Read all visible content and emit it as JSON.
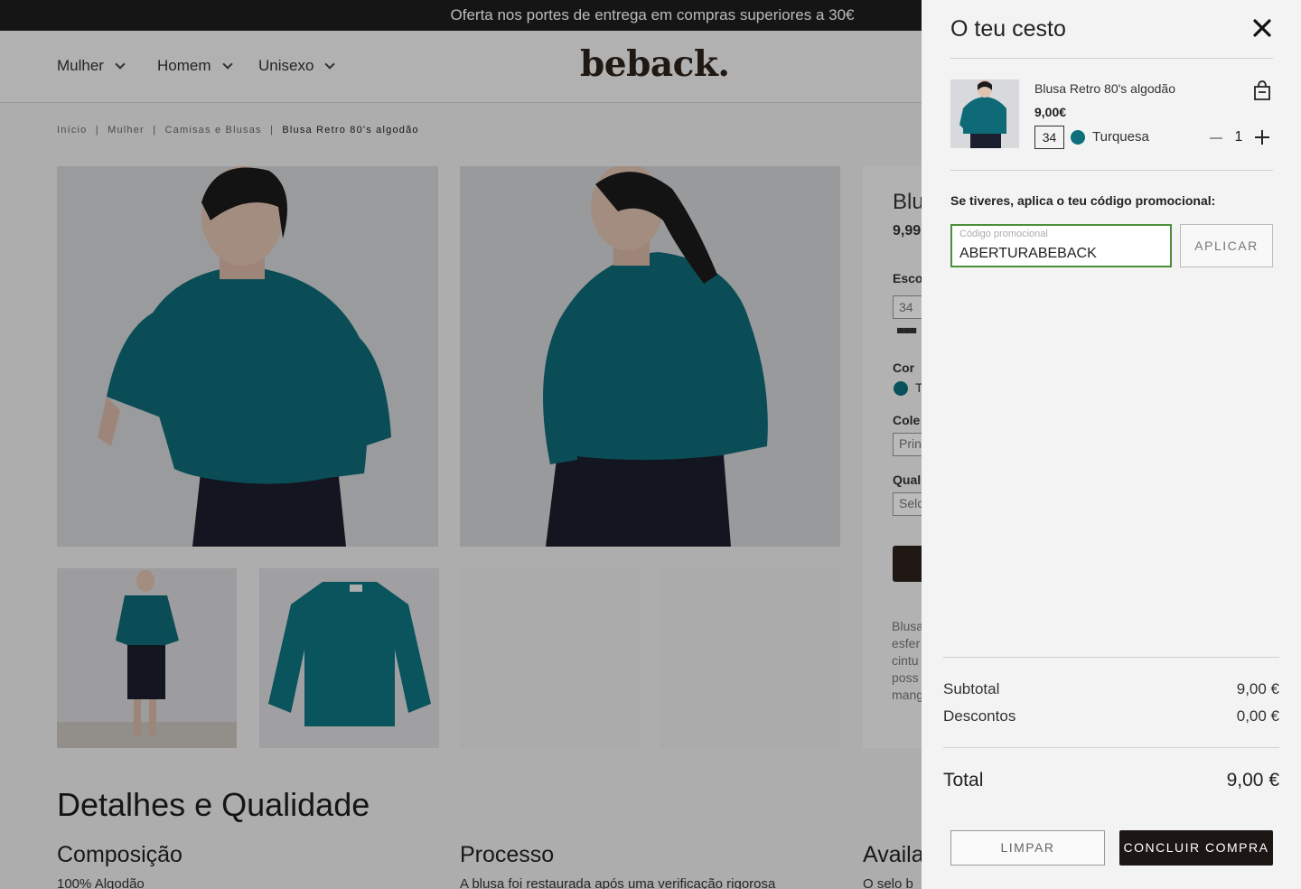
{
  "promo_bar": {
    "text": "Oferta nos portes de entrega em compras superiores a 30€"
  },
  "header": {
    "nav": [
      "Mulher",
      "Homem",
      "Unisexo"
    ],
    "logo": "beback."
  },
  "breadcrumb": {
    "items": [
      "Início",
      "Mulher",
      "Camisas e Blusas"
    ],
    "separator": "|",
    "current": "Blusa Retro 80's algodão"
  },
  "product_partial": {
    "title_cut": "Blu",
    "price_cut": "9,99",
    "size_label_cut": "Esco",
    "size_value": "34",
    "color_label": "Cor",
    "color_value_cut": "T",
    "collection_label_cut": "Cole",
    "collection_value_cut": "Prin",
    "quality_label_cut": "Qual",
    "quality_value_cut": "Selc",
    "description_cut": [
      "Blusa",
      "esfer",
      "cintu",
      "poss",
      "mang"
    ]
  },
  "details": {
    "heading": "Detalhes e Qualidade",
    "columns": [
      {
        "title": "Composição",
        "text": "100% Algodão"
      },
      {
        "title": "Processo",
        "text": "A blusa foi restaurada após uma verificação rigorosa"
      },
      {
        "title": "Availa",
        "text": "O selo b"
      }
    ]
  },
  "cart": {
    "title": "O teu cesto",
    "item": {
      "name": "Blusa Retro 80's algodão",
      "price": "9,00€",
      "size": "34",
      "color": "Turquesa",
      "quantity": "1"
    },
    "promo_label": "Se tiveres, aplica o teu código promocional:",
    "promo_placeholder": "Código promocional",
    "promo_value": "ABERTURABEBACK",
    "apply_label": "APLICAR",
    "subtotal_label": "Subtotal",
    "subtotal_value": "9,00 €",
    "discount_label": "Descontos",
    "discount_value": "0,00 €",
    "total_label": "Total",
    "total_value": "9,00 €",
    "clear_label": "LIMPAR",
    "checkout_label": "CONCLUIR COMPRA"
  },
  "colors": {
    "accent_teal": "#0d6f7c",
    "dark_brown": "#2b211c",
    "focus_green": "#4a8f3c"
  }
}
